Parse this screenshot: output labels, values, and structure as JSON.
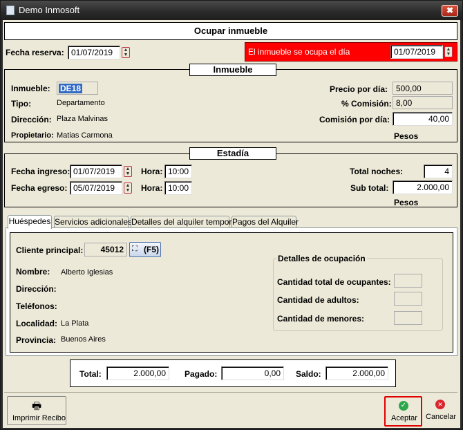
{
  "window": {
    "title": "Demo Inmosoft",
    "close_glyph": "✖"
  },
  "header": {
    "title": "Ocupar inmueble"
  },
  "reserva": {
    "label": "Fecha reserva:",
    "value": "01/07/2019"
  },
  "alert": {
    "text": "El inmueble se ocupa el día",
    "date": "01/07/2019",
    "color": "#ff0000"
  },
  "inmueble": {
    "section_title": "Inmueble",
    "inmueble_label": "Inmueble:",
    "inmueble_value": "DE18",
    "tipo_label": "Tipo:",
    "tipo_value": "Departamento",
    "direccion_label": "Dirección:",
    "direccion_value": "Plaza Malvinas",
    "propietario_label": "Propietario:",
    "propietario_value": "Matias Carmona",
    "precio_label": "Precio por día:",
    "precio_value": "500,00",
    "comision_pct_label": "% Comisión:",
    "comision_pct_value": "8,00",
    "comision_dia_label": "Comisión por día:",
    "comision_dia_value": "40,00",
    "currency_label": "Pesos"
  },
  "estadia": {
    "section_title": "Estadía",
    "ingreso_label": "Fecha ingreso:",
    "ingreso_value": "01/07/2019",
    "egreso_label": "Fecha egreso:",
    "egreso_value": "05/07/2019",
    "hora_label": "Hora:",
    "hora_ingreso": "10:00",
    "hora_egreso": "10:00",
    "noches_label": "Total noches:",
    "noches_value": "4",
    "subtotal_label": "Sub total:",
    "subtotal_value": "2.000,00",
    "currency_label": "Pesos"
  },
  "tabs": [
    {
      "label": "Huéspedes"
    },
    {
      "label": "Servicios adicionales"
    },
    {
      "label": "Detalles del alquiler temporal"
    },
    {
      "label": "Pagos del Alquiler"
    }
  ],
  "huespedes": {
    "cliente_label": "Cliente principal:",
    "cliente_value": "45012",
    "f5_label": "(F5)",
    "nombre_label": "Nombre:",
    "nombre_value": "Alberto Iglesias",
    "direccion_label": "Dirección:",
    "direccion_value": "",
    "telefonos_label": "Teléfonos:",
    "telefonos_value": "",
    "localidad_label": "Localidad:",
    "localidad_value": "La Plata",
    "provincia_label": "Provincia:",
    "provincia_value": "Buenos Aires",
    "ocupacion_title": "Detalles de ocupación",
    "ocupantes_label": "Cantidad total de ocupantes:",
    "ocupantes_value": "",
    "adultos_label": "Cantidad de adultos:",
    "adultos_value": "",
    "menores_label": "Cantidad de menores:",
    "menores_value": ""
  },
  "totals": {
    "total_label": "Total:",
    "total_value": "2.000,00",
    "pagado_label": "Pagado:",
    "pagado_value": "0,00",
    "saldo_label": "Saldo:",
    "saldo_value": "2.000,00"
  },
  "footer": {
    "imprimir_label": "Imprimir Recibo",
    "aceptar_label": "Aceptar",
    "cancelar_label": "Cancelar"
  }
}
